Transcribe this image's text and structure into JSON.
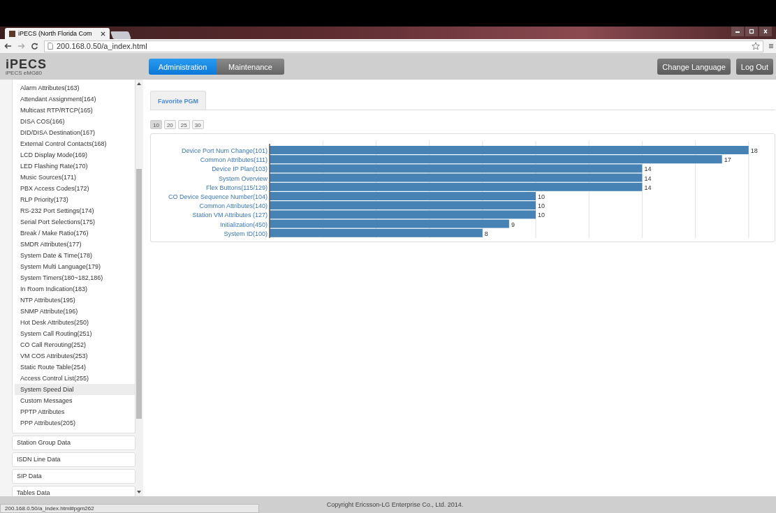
{
  "browser": {
    "tab_title": "iPECS (North Florida Com",
    "address": "200.168.0.50/a_index.html"
  },
  "header": {
    "logo": "iPECS",
    "product": "iPECS eMG80",
    "nav": [
      {
        "label": "Administration",
        "selected": true
      },
      {
        "label": "Maintenance",
        "selected": false
      }
    ],
    "buttons": [
      "Change Language",
      "Log Out"
    ]
  },
  "sidebar": {
    "items": [
      {
        "label": "Alarm Attributes(163)",
        "selected": false
      },
      {
        "label": "Attendant Assignment(164)",
        "selected": false
      },
      {
        "label": "Multicast RTP/RTCP(165)",
        "selected": false
      },
      {
        "label": "DISA COS(166)",
        "selected": false
      },
      {
        "label": "DID/DISA Destination(167)",
        "selected": false
      },
      {
        "label": "External Control Contacts(168)",
        "selected": false
      },
      {
        "label": "LCD Display Mode(169)",
        "selected": false
      },
      {
        "label": "LED Flashing Rate(170)",
        "selected": false
      },
      {
        "label": "Music Sources(171)",
        "selected": false
      },
      {
        "label": "PBX Access Codes(172)",
        "selected": false
      },
      {
        "label": "RLP Priority(173)",
        "selected": false
      },
      {
        "label": "RS-232 Port Settings(174)",
        "selected": false
      },
      {
        "label": "Serial Port Selections(175)",
        "selected": false
      },
      {
        "label": "Break / Make Ratio(176)",
        "selected": false
      },
      {
        "label": "SMDR Attributes(177)",
        "selected": false
      },
      {
        "label": "System Date & Time(178)",
        "selected": false
      },
      {
        "label": "System Multi Language(179)",
        "selected": false
      },
      {
        "label": "System Timers(180~182,186)",
        "selected": false
      },
      {
        "label": "In Room Indication(183)",
        "selected": false
      },
      {
        "label": "NTP Attributes(195)",
        "selected": false
      },
      {
        "label": "SNMP Attribute(196)",
        "selected": false
      },
      {
        "label": "Hot Desk Attributes(250)",
        "selected": false
      },
      {
        "label": "System Call Routing(251)",
        "selected": false
      },
      {
        "label": "CO Call Rerouting(252)",
        "selected": false
      },
      {
        "label": "VM COS Attributes(253)",
        "selected": false
      },
      {
        "label": "Static Route Table(254)",
        "selected": false
      },
      {
        "label": "Access Control List(255)",
        "selected": false
      },
      {
        "label": "System Speed Dial",
        "selected": true
      },
      {
        "label": "Custom Messages",
        "selected": false
      },
      {
        "label": "PPTP Attributes",
        "selected": false
      },
      {
        "label": "PPP Attributes(205)",
        "selected": false
      }
    ],
    "sections": [
      "Station Group Data",
      "ISDN Line Data",
      "SIP Data",
      "Tables Data"
    ]
  },
  "content": {
    "tabs": [
      {
        "label": "Favorite PGM",
        "selected": true
      }
    ],
    "page_sizes": [
      {
        "label": "10",
        "selected": true
      },
      {
        "label": "20",
        "selected": false
      },
      {
        "label": "25",
        "selected": false
      },
      {
        "label": "30",
        "selected": false
      }
    ],
    "chart_data": {
      "type": "bar",
      "orientation": "horizontal",
      "data_labels": true,
      "xlim": [
        0,
        18
      ],
      "categories": [
        "Device Port Num Change(101)",
        "Common Attributes(111)",
        "Device IP Plan(103)",
        "System Overview",
        "Flex Buttons(115/129)",
        "CO Device Sequence Number(104)",
        "Common Attributes(140)",
        "Station VM Attributes (127)",
        "Initialization(450)",
        "System ID(100)"
      ],
      "series": [
        {
          "color": "#4682b4",
          "values": [
            18,
            17,
            14,
            14,
            14,
            10,
            10,
            10,
            9,
            8
          ]
        }
      ]
    }
  },
  "footer": {
    "copyright": "Copyright Ericsson-LG Enterprise Co., Ltd. 2014.",
    "status_url": "200.168.0.50/a_index.html#pgm262"
  }
}
